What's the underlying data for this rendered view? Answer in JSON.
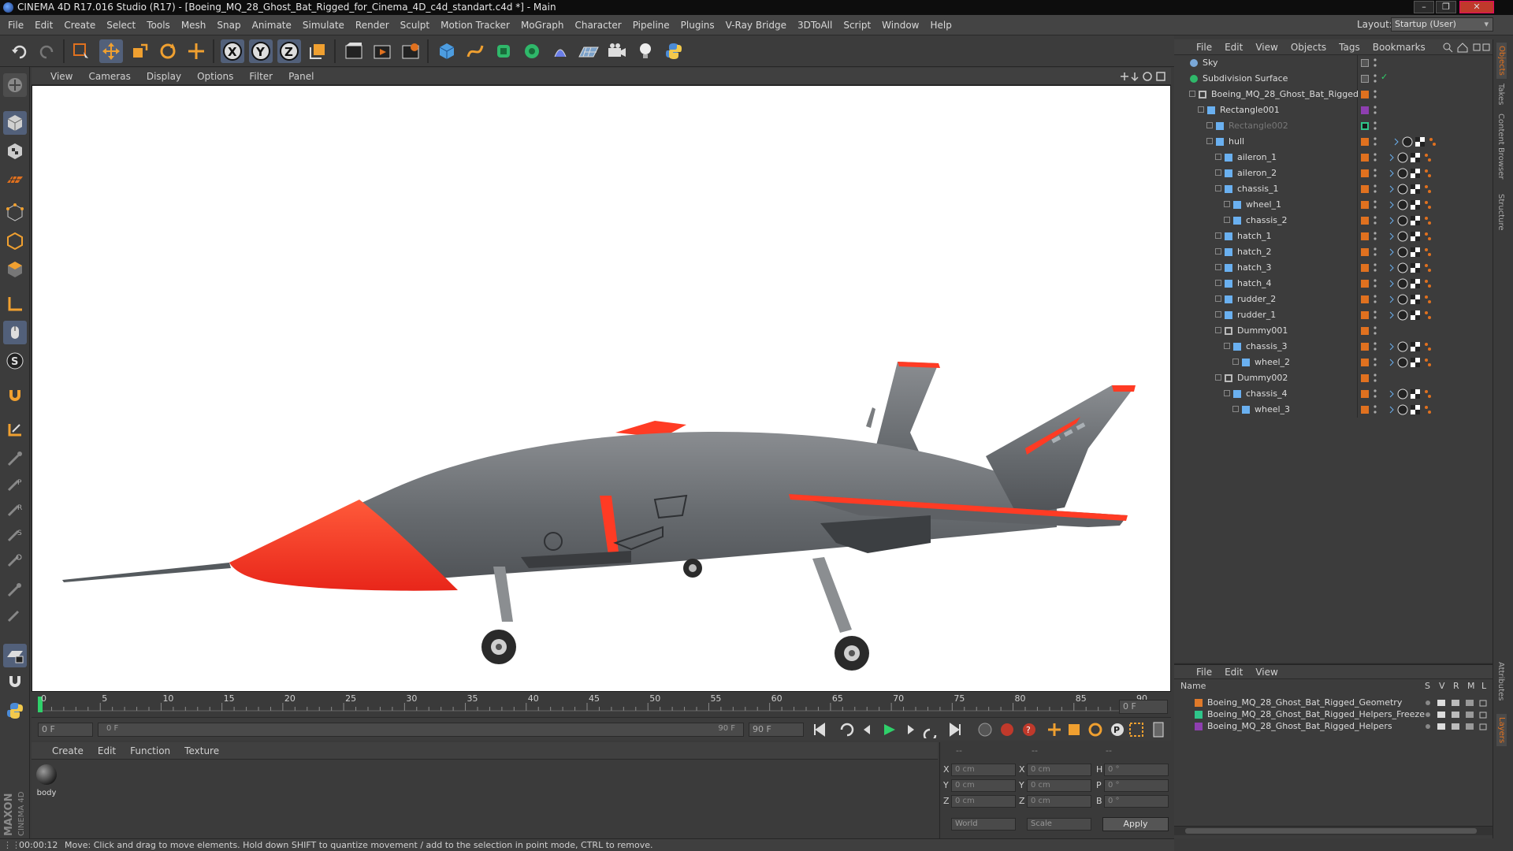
{
  "window": {
    "title": "CINEMA 4D R17.016 Studio (R17) - [Boeing_MQ_28_Ghost_Bat_Rigged_for_Cinema_4D_c4d_standart.c4d *] - Main"
  },
  "menu": [
    "File",
    "Edit",
    "Create",
    "Select",
    "Tools",
    "Mesh",
    "Snap",
    "Animate",
    "Simulate",
    "Render",
    "Sculpt",
    "Motion Tracker",
    "MoGraph",
    "Character",
    "Pipeline",
    "Plugins",
    "V-Ray Bridge",
    "3DToAll",
    "Script",
    "Window",
    "Help"
  ],
  "layout": {
    "label": "Layout:",
    "value": "Startup (User)"
  },
  "viewport": {
    "menu": [
      "View",
      "Cameras",
      "Display",
      "Options",
      "Filter",
      "Panel"
    ]
  },
  "timeline": {
    "ticks": [
      "0",
      "5",
      "10",
      "15",
      "20",
      "25",
      "30",
      "35",
      "40",
      "45",
      "50",
      "55",
      "60",
      "65",
      "70",
      "75",
      "80",
      "85",
      "90"
    ],
    "frame_field": "0 F",
    "start_field": "0 F",
    "range_start": "0 F",
    "range_end": "90 F",
    "end_field": "90 F"
  },
  "material_manager": {
    "menu": [
      "Create",
      "Edit",
      "Function",
      "Texture"
    ],
    "materials": [
      {
        "name": "body"
      }
    ]
  },
  "coordinates": {
    "headers": [
      "--",
      "--",
      "--"
    ],
    "rows": [
      {
        "a": "X",
        "av": "0 cm",
        "b": "X",
        "bv": "0 cm",
        "c": "H",
        "cv": "0 °"
      },
      {
        "a": "Y",
        "av": "0 cm",
        "b": "Y",
        "bv": "0 cm",
        "c": "P",
        "cv": "0 °"
      },
      {
        "a": "Z",
        "av": "0 cm",
        "b": "Z",
        "bv": "0 cm",
        "c": "B",
        "cv": "0 °"
      }
    ],
    "mode1": "World",
    "mode2": "Scale",
    "apply": "Apply"
  },
  "status": {
    "time": "00:00:12",
    "message": "Move: Click and drag to move elements. Hold down SHIFT to quantize movement / add to the selection in point mode, CTRL to remove."
  },
  "object_manager": {
    "menu": [
      "File",
      "Edit",
      "View",
      "Objects",
      "Tags",
      "Bookmarks"
    ],
    "objects": [
      {
        "name": "Sky",
        "level": 0
      },
      {
        "name": "Subdivision Surface",
        "level": 0
      },
      {
        "name": "Boeing_MQ_28_Ghost_Bat_Rigged",
        "level": 1
      },
      {
        "name": "Rectangle001",
        "level": 2
      },
      {
        "name": "Rectangle002",
        "level": 3
      },
      {
        "name": "hull",
        "level": 3
      },
      {
        "name": "aileron_1",
        "level": 4
      },
      {
        "name": "aileron_2",
        "level": 4
      },
      {
        "name": "chassis_1",
        "level": 4
      },
      {
        "name": "wheel_1",
        "level": 5
      },
      {
        "name": "chassis_2",
        "level": 5
      },
      {
        "name": "hatch_1",
        "level": 4
      },
      {
        "name": "hatch_2",
        "level": 4
      },
      {
        "name": "hatch_3",
        "level": 4
      },
      {
        "name": "hatch_4",
        "level": 4
      },
      {
        "name": "rudder_2",
        "level": 4
      },
      {
        "name": "rudder_1",
        "level": 4
      },
      {
        "name": "Dummy001",
        "level": 4
      },
      {
        "name": "chassis_3",
        "level": 5
      },
      {
        "name": "wheel_2",
        "level": 6
      },
      {
        "name": "Dummy002",
        "level": 4
      },
      {
        "name": "chassis_4",
        "level": 5
      },
      {
        "name": "wheel_3",
        "level": 6
      }
    ]
  },
  "layer_manager": {
    "menu": [
      "File",
      "Edit",
      "View"
    ],
    "headers": {
      "name": "Name",
      "s": "S",
      "v": "V",
      "r": "R",
      "m": "M",
      "l": "L"
    },
    "layers": [
      {
        "name": "Boeing_MQ_28_Ghost_Bat_Rigged_Geometry",
        "color": "#e07a2a"
      },
      {
        "name": "Boeing_MQ_28_Ghost_Bat_Rigged_Helpers_Freeze",
        "color": "#2fc58a"
      },
      {
        "name": "Boeing_MQ_28_Ghost_Bat_Rigged_Helpers",
        "color": "#8e3fb0"
      }
    ]
  },
  "side_tabs": [
    "Objects",
    "Takes",
    "Content Browser",
    "Structure",
    "Attributes",
    "Layers"
  ],
  "brand": "MAXON CINEMA 4D",
  "colors": {
    "accent_orange": "#e0711f",
    "drone_red": "#ff3b24",
    "drone_gray": "#6b6e72"
  }
}
